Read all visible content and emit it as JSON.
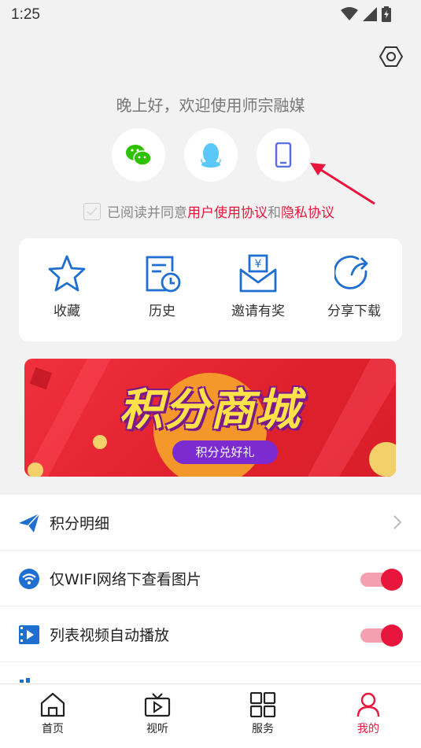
{
  "status": {
    "time": "1:25"
  },
  "header": {
    "greeting": "晚上好，欢迎使用师宗融媒"
  },
  "login": {
    "options": [
      {
        "icon": "wechat-icon"
      },
      {
        "icon": "qq-icon"
      },
      {
        "icon": "phone-icon"
      }
    ]
  },
  "agreement": {
    "prefix": "已阅读并同意",
    "user_link": "用户使用协议",
    "and": "和",
    "privacy_link": "隐私协议",
    "checked": false
  },
  "quick_actions": [
    {
      "label": "收藏",
      "icon": "star-icon"
    },
    {
      "label": "历史",
      "icon": "history-icon"
    },
    {
      "label": "邀请有奖",
      "icon": "invite-icon"
    },
    {
      "label": "分享下载",
      "icon": "share-icon"
    }
  ],
  "banner": {
    "title": "积分商城",
    "subtitle": "积分兑好礼"
  },
  "settings_list": [
    {
      "label": "积分明细",
      "icon": "paper-plane-icon",
      "type": "link"
    },
    {
      "label": "仅WIFI网络下查看图片",
      "icon": "wifi-icon",
      "type": "toggle",
      "on": true
    },
    {
      "label": "列表视频自动播放",
      "icon": "video-icon",
      "type": "toggle",
      "on": true
    }
  ],
  "tabs": [
    {
      "label": "首页",
      "icon": "home-icon",
      "active": false
    },
    {
      "label": "视听",
      "icon": "tv-icon",
      "active": false
    },
    {
      "label": "服务",
      "icon": "grid-icon",
      "active": false
    },
    {
      "label": "我的",
      "icon": "user-icon",
      "active": true
    }
  ],
  "colors": {
    "accent": "#e8163c",
    "brand_blue": "#1f6fd1",
    "wechat": "#2dc100",
    "qq": "#5ac8fa",
    "phone": "#5a6ee0"
  }
}
